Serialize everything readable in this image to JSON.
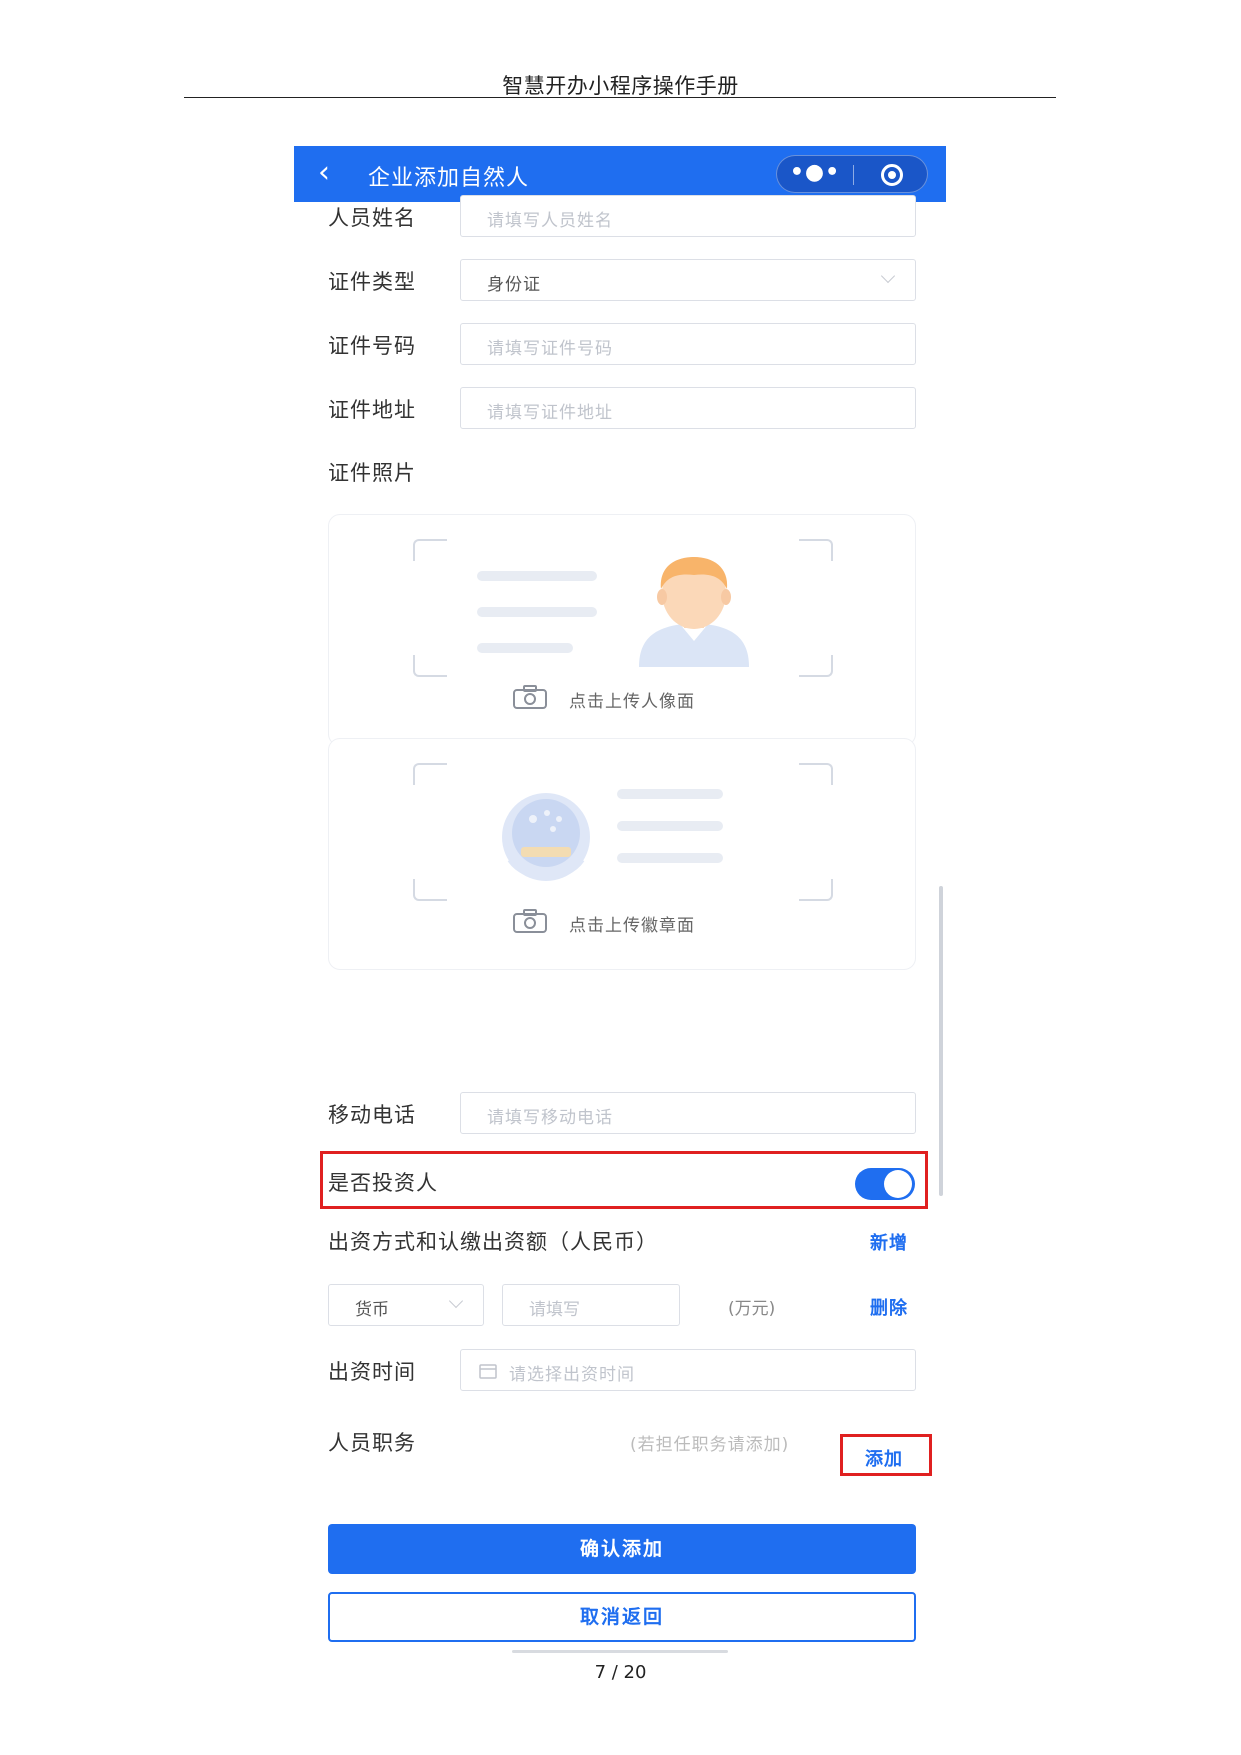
{
  "document": {
    "header_title": "智慧开办小程序操作手册",
    "page_number": "7 / 20"
  },
  "navbar": {
    "back_icon": "‹",
    "title": "企业添加自然人",
    "more_icon": "•●•",
    "background_color": "#1f6ef0"
  },
  "form": {
    "name": {
      "label": "人员姓名",
      "placeholder": "请填写人员姓名"
    },
    "id_type": {
      "label": "证件类型",
      "value": "身份证"
    },
    "id_number": {
      "label": "证件号码",
      "placeholder": "请填写证件号码"
    },
    "id_address": {
      "label": "证件地址",
      "placeholder": "请填写证件地址"
    },
    "id_photo": {
      "label": "证件照片",
      "front_text": "点击上传人像面",
      "back_text": "点击上传徽章面"
    },
    "mobile": {
      "label": "移动电话",
      "placeholder": "请填写移动电话"
    },
    "investor": {
      "label": "是否投资人",
      "enabled": true
    },
    "contribution": {
      "label": "出资方式和认缴出资额（人民币）",
      "add_link": "新增",
      "currency_value": "货币",
      "amount_placeholder": "请填写",
      "unit": "(万元)",
      "delete_link": "删除"
    },
    "contribution_time": {
      "label": "出资时间",
      "placeholder": "请选择出资时间"
    },
    "position": {
      "label": "人员职务",
      "hint": "(若担任职务请添加)",
      "add_link": "添加"
    }
  },
  "buttons": {
    "confirm": "确认添加",
    "cancel": "取消返回"
  },
  "colors": {
    "primary": "#1f6ef0",
    "highlight": "#e02020"
  }
}
